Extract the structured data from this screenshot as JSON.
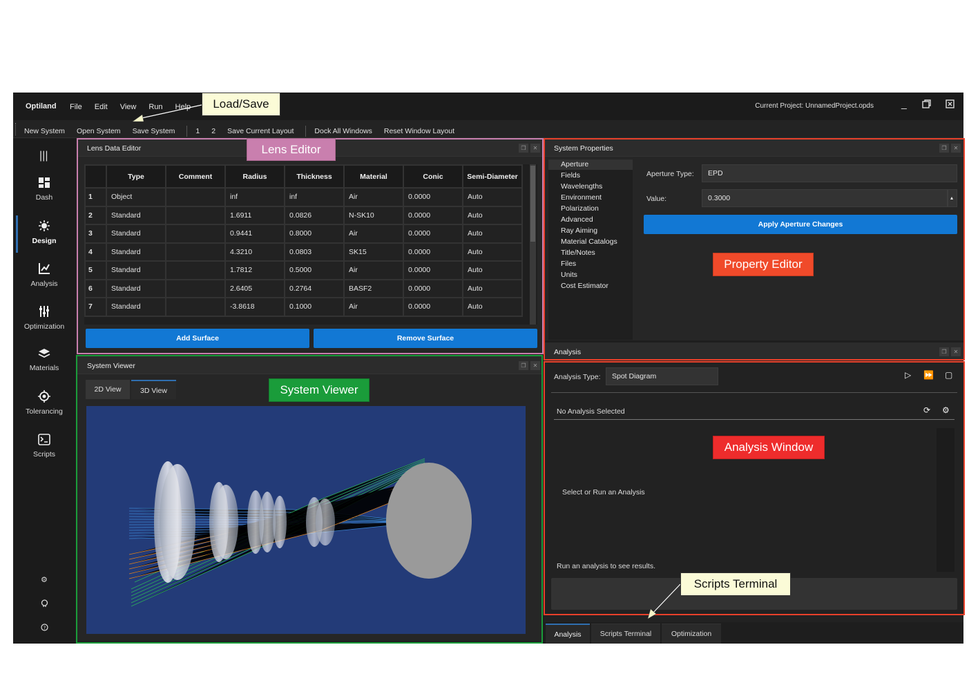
{
  "app": {
    "name": "Optiland",
    "menu": [
      "File",
      "Edit",
      "View",
      "Run",
      "Help"
    ],
    "project": "Current Project: UnnamedProject.opds"
  },
  "toolbar": {
    "new_system": "New System",
    "open_system": "Open System",
    "save_system": "Save System",
    "layout_1": "1",
    "layout_2": "2",
    "save_layout": "Save Current Layout",
    "dock_all": "Dock All Windows",
    "reset_layout": "Reset Window Layout"
  },
  "sidebar": {
    "items": [
      {
        "label": "Dash",
        "icon": "dashboard-icon"
      },
      {
        "label": "Design",
        "icon": "design-icon"
      },
      {
        "label": "Analysis",
        "icon": "analysis-icon"
      },
      {
        "label": "Optimization",
        "icon": "optimization-icon"
      },
      {
        "label": "Materials",
        "icon": "materials-icon"
      },
      {
        "label": "Tolerancing",
        "icon": "tolerancing-icon"
      },
      {
        "label": "Scripts",
        "icon": "scripts-icon"
      }
    ],
    "active": "Design"
  },
  "lens_editor": {
    "title": "Lens Data Editor",
    "columns": [
      "",
      "Type",
      "Comment",
      "Radius",
      "Thickness",
      "Material",
      "Conic",
      "Semi-Diameter"
    ],
    "rows": [
      [
        "1",
        "Object",
        "",
        "inf",
        "inf",
        "Air",
        "0.0000",
        "Auto"
      ],
      [
        "2",
        "Standard",
        "",
        "1.6911",
        "0.0826",
        "N-SK10",
        "0.0000",
        "Auto"
      ],
      [
        "3",
        "Standard",
        "",
        "0.9441",
        "0.8000",
        "Air",
        "0.0000",
        "Auto"
      ],
      [
        "4",
        "Standard",
        "",
        "4.3210",
        "0.0803",
        "SK15",
        "0.0000",
        "Auto"
      ],
      [
        "5",
        "Standard",
        "",
        "1.7812",
        "0.5000",
        "Air",
        "0.0000",
        "Auto"
      ],
      [
        "6",
        "Standard",
        "",
        "2.6405",
        "0.2764",
        "BASF2",
        "0.0000",
        "Auto"
      ],
      [
        "7",
        "Standard",
        "",
        "-3.8618",
        "0.1000",
        "Air",
        "0.0000",
        "Auto"
      ]
    ],
    "add_surface": "Add Surface",
    "remove_surface": "Remove Surface"
  },
  "system_viewer": {
    "title": "System Viewer",
    "tabs": [
      "2D View",
      "3D View"
    ],
    "active_tab": "3D View"
  },
  "system_properties": {
    "title": "System Properties",
    "categories": [
      "Aperture",
      "Fields",
      "Wavelengths",
      "Environment",
      "Polarization",
      "Advanced",
      "Ray Aiming",
      "Material Catalogs",
      "Title/Notes",
      "Files",
      "Units",
      "Cost Estimator"
    ],
    "selected": "Aperture",
    "aperture_type_label": "Aperture Type:",
    "aperture_type_value": "EPD",
    "value_label": "Value:",
    "value": "0.3000",
    "apply_button": "Apply Aperture Changes"
  },
  "analysis": {
    "title": "Analysis",
    "type_label": "Analysis Type:",
    "type_value": "Spot Diagram",
    "no_selection": "No Analysis Selected",
    "placeholder": "Select or Run an Analysis",
    "hint": "Run an analysis to see results."
  },
  "bottom_tabs": [
    "Analysis",
    "Scripts Terminal",
    "Optimization"
  ],
  "annotations": {
    "load_save": "Load/Save",
    "lens_editor": "Lens Editor",
    "system_viewer": "System Viewer",
    "property_editor": "Property Editor",
    "analysis_window": "Analysis Window",
    "scripts_terminal": "Scripts Terminal"
  },
  "colors": {
    "accent_blue": "#1278d4",
    "lens_editor_box": "#c97fae",
    "system_viewer_box": "#1a9c3a",
    "property_editor_box": "#e8402a",
    "viewport_bg": "#233b78"
  }
}
